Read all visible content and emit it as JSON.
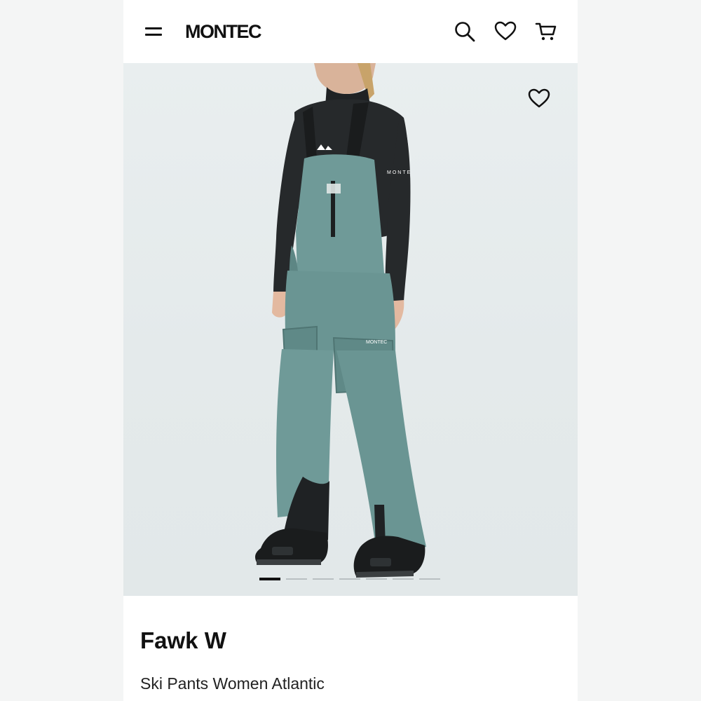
{
  "header": {
    "logo": "MONTEC",
    "icons": [
      "menu-icon",
      "search-icon",
      "heart-icon",
      "cart-icon"
    ]
  },
  "gallery": {
    "image": "product-photo",
    "carousel_pages": 7,
    "active_page": 1
  },
  "product": {
    "name": "Fawk W",
    "description": "Ski Pants Women Atlantic"
  },
  "colors": {
    "background": "#f4f5f5",
    "surface": "#ffffff",
    "gallery_bg": "#e6ebec",
    "product_teal": "#6f9a98",
    "text": "#111111",
    "dot_inactive": "#b9c0c2"
  }
}
